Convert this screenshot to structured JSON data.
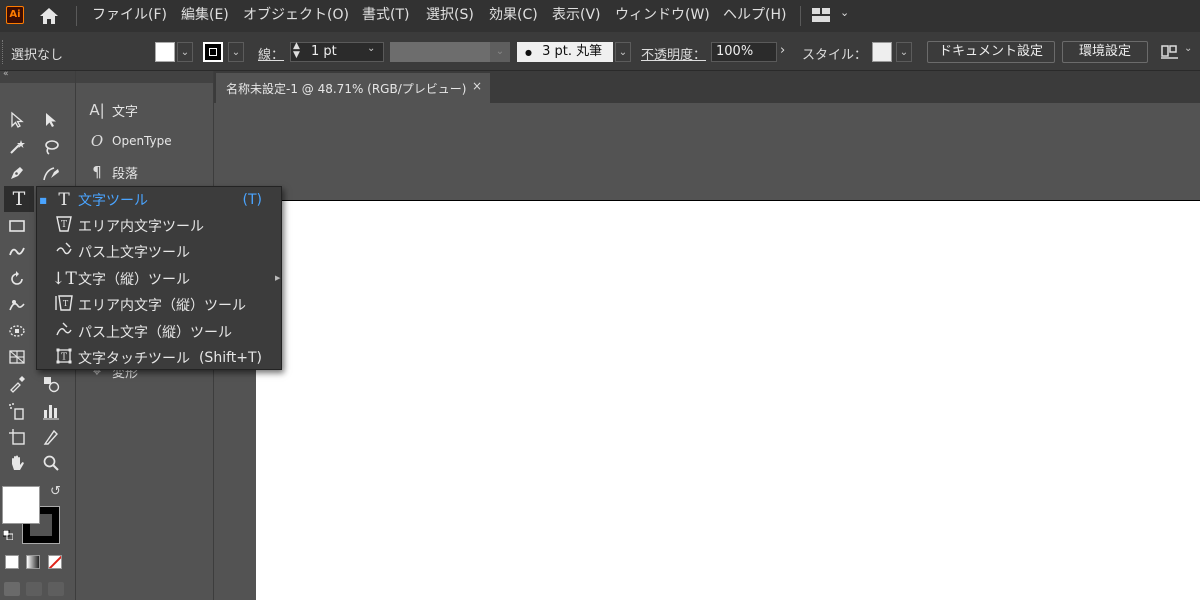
{
  "app": {
    "logo_text": "Ai"
  },
  "menu": {
    "items": [
      "ファイル(F)",
      "編集(E)",
      "オブジェクト(O)",
      "書式(T)",
      "選択(S)",
      "効果(C)",
      "表示(V)",
      "ウィンドウ(W)",
      "ヘルプ(H)"
    ]
  },
  "control_bar": {
    "selection": "選択なし",
    "stroke_label": "線：",
    "stroke_weight": "1 pt",
    "brush": "3 pt. 丸筆",
    "opacity_label": "不透明度：",
    "opacity_value": "100%",
    "style_label": "スタイル：",
    "document_setup": "ドキュメント設定",
    "preferences": "環境設定"
  },
  "document": {
    "tab_title": "名称未設定-1 @ 48.71% (RGB/プレビュー)",
    "close_symbol": "×"
  },
  "panels": {
    "items": [
      {
        "icon": "character-panel-icon",
        "label": "文字"
      },
      {
        "icon": "opentype-panel-icon",
        "label": "OpenType"
      },
      {
        "icon": "paragraph-panel-icon",
        "label": "段落"
      }
    ],
    "hidden_label": "変形"
  },
  "type_flyout": {
    "items": [
      {
        "label": "文字ツール",
        "shortcut": "(T)",
        "active": true,
        "icon": "type-tool-icon"
      },
      {
        "label": "エリア内文字ツール",
        "shortcut": "",
        "active": false,
        "icon": "area-type-tool-icon"
      },
      {
        "label": "パス上文字ツール",
        "shortcut": "",
        "active": false,
        "icon": "type-on-path-tool-icon"
      },
      {
        "label": "文字（縦）ツール",
        "shortcut": "",
        "active": false,
        "icon": "vertical-type-tool-icon"
      },
      {
        "label": "エリア内文字（縦）ツール",
        "shortcut": "",
        "active": false,
        "icon": "vertical-area-type-tool-icon"
      },
      {
        "label": "パス上文字（縦）ツール",
        "shortcut": "",
        "active": false,
        "icon": "vertical-type-on-path-tool-icon"
      },
      {
        "label": "文字タッチツール",
        "shortcut": "(Shift+T)",
        "active": false,
        "icon": "touch-type-tool-icon"
      }
    ]
  },
  "colors": {
    "accent": "#4aa4ff",
    "logo_orange": "#ff7c00",
    "menubar_bg": "#323232",
    "panel_bg": "#535353",
    "artboard": "#ffffff"
  }
}
